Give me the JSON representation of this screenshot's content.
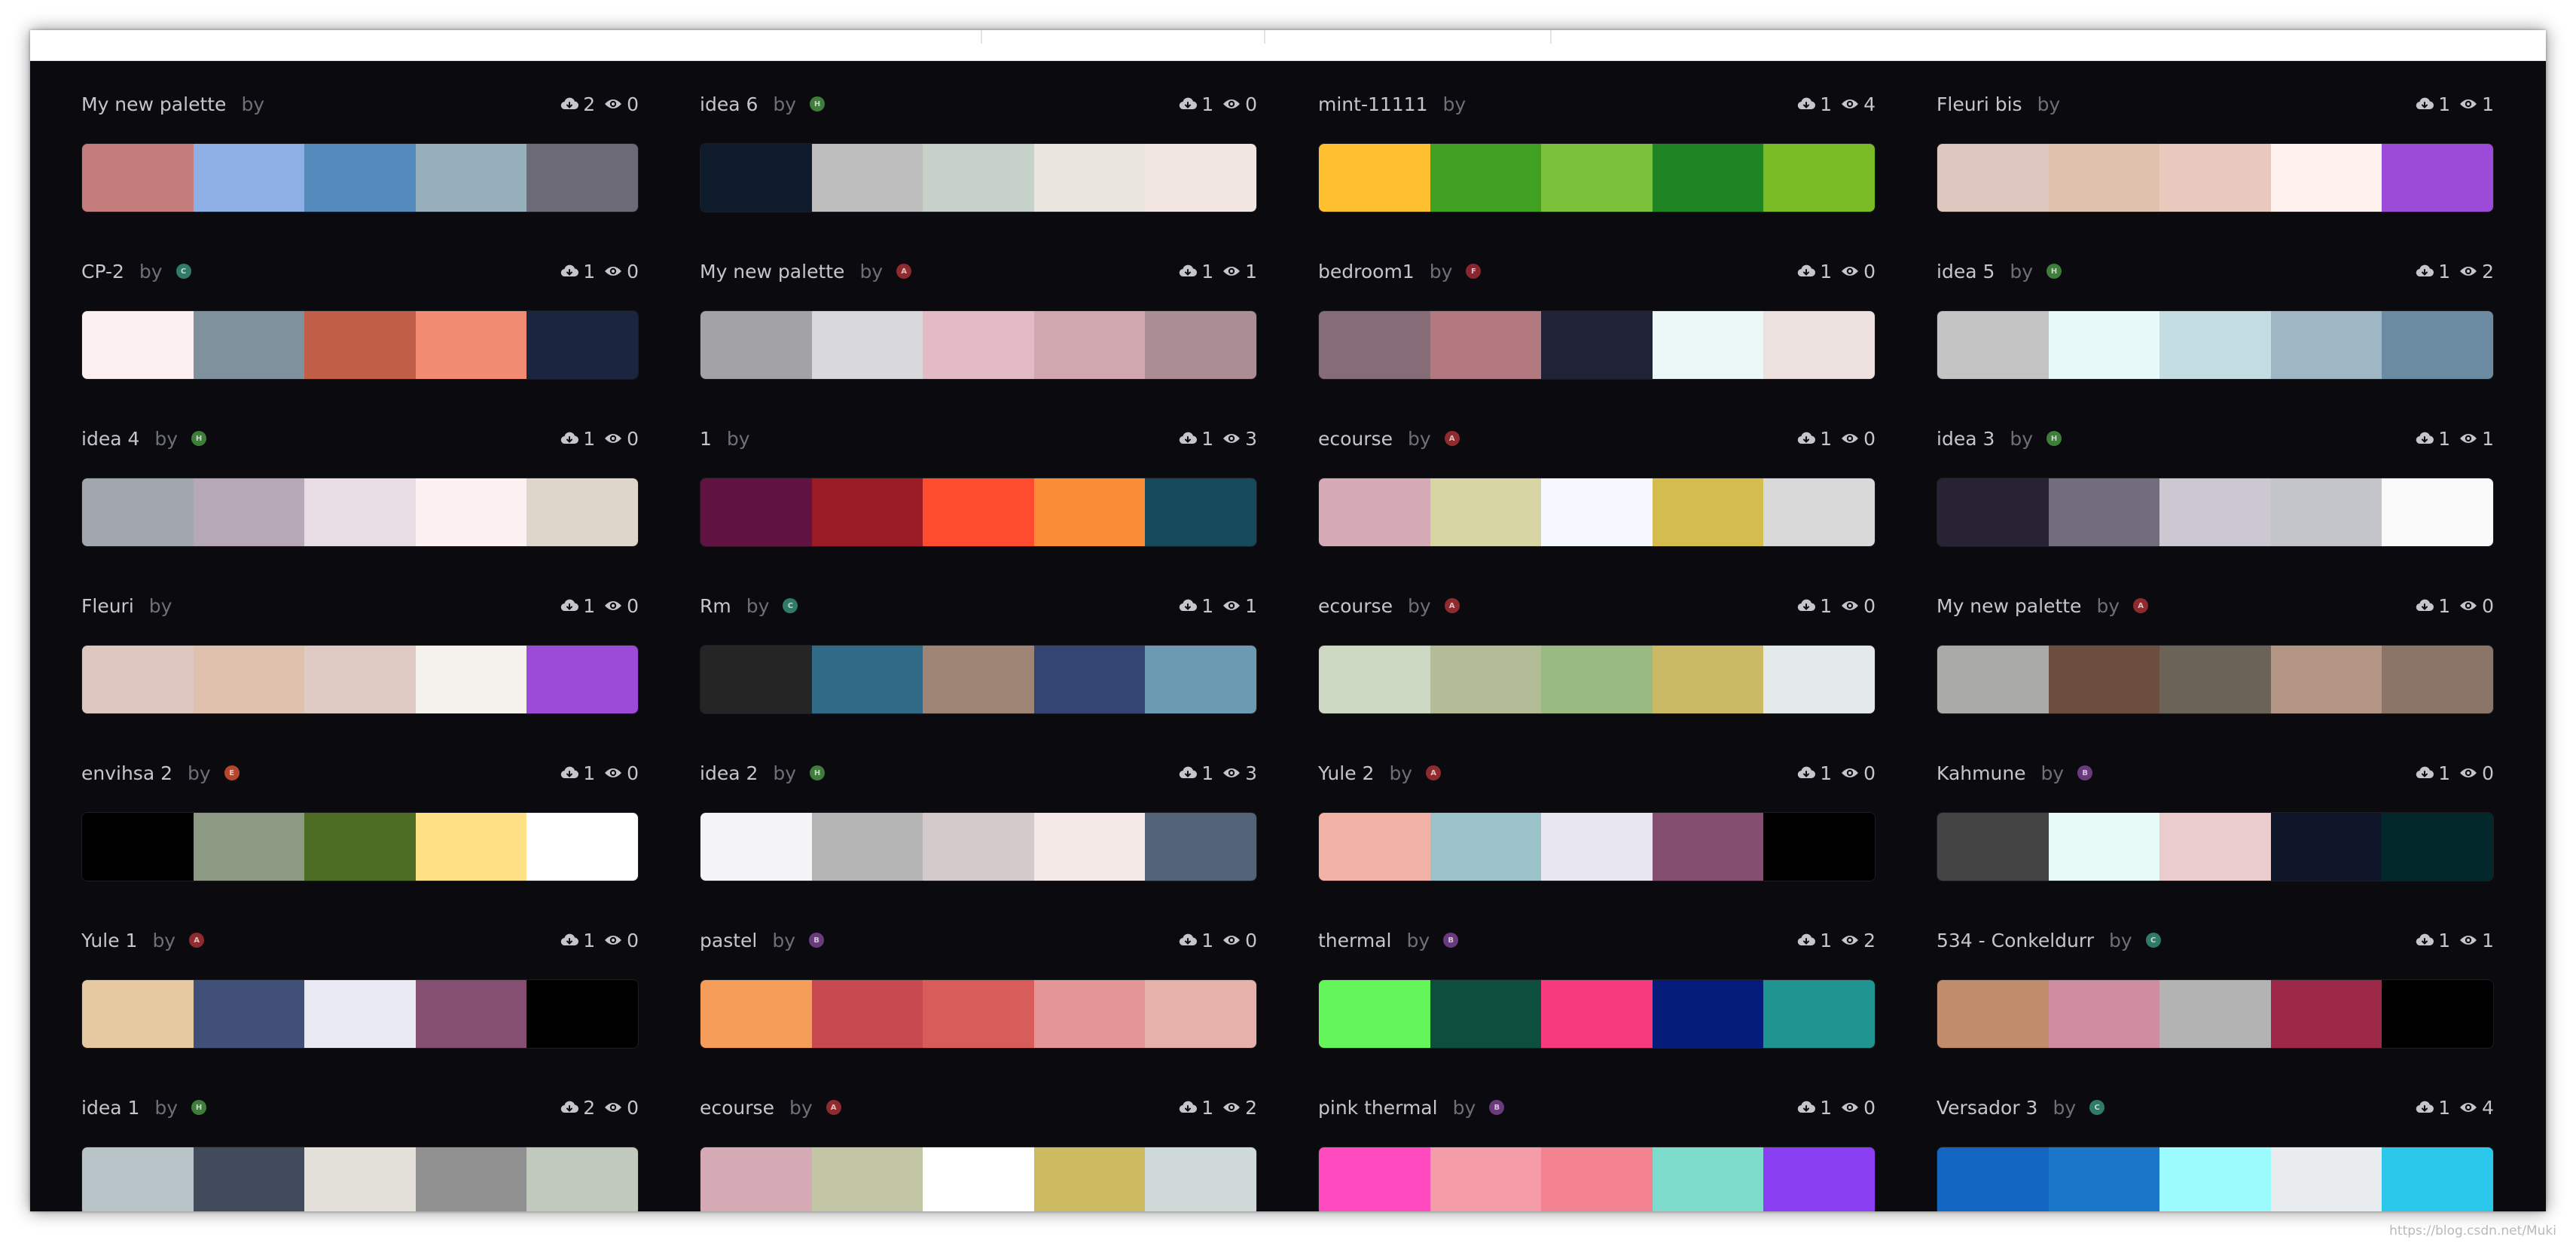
{
  "by_label": "by",
  "icons": {
    "downloads": "cloud-download-icon",
    "views": "eye-icon"
  },
  "watermark": "https://blog.csdn.net/Muki",
  "palettes": [
    {
      "name": "My new palette",
      "avatar": null,
      "downloads": "2",
      "views": "0",
      "colors": [
        "#c47c7c",
        "#8eaee6",
        "#548abc",
        "#97afbb",
        "#6d6a78"
      ]
    },
    {
      "name": "idea 6",
      "avatar": {
        "letter": "H",
        "color": "#3e7d3a"
      },
      "downloads": "1",
      "views": "0",
      "colors": [
        "#0e1c2c",
        "#bebebe",
        "#c6d1c9",
        "#ebe5df",
        "#f1e6e1"
      ]
    },
    {
      "name": "mint-11111",
      "avatar": null,
      "downloads": "1",
      "views": "4",
      "colors": [
        "#fec02f",
        "#40a022",
        "#7bc23a",
        "#1f8422",
        "#79bb25"
      ]
    },
    {
      "name": "Fleuri bis",
      "avatar": null,
      "downloads": "1",
      "views": "1",
      "colors": [
        "#ddc7bf",
        "#e0c1ad",
        "#e8c9bd",
        "#fff1ed",
        "#9c4bd8"
      ]
    },
    {
      "name": "CP-2",
      "avatar": {
        "letter": "C",
        "color": "#2f7a68"
      },
      "downloads": "1",
      "views": "0",
      "colors": [
        "#fcf0f0",
        "#7f919c",
        "#c05e47",
        "#f18b71",
        "#1c2540"
      ]
    },
    {
      "name": "My new palette",
      "avatar": {
        "letter": "A",
        "color": "#8f2a2f"
      },
      "downloads": "1",
      "views": "1",
      "colors": [
        "#a3a3a6",
        "#d9d9db",
        "#e3bbc4",
        "#d0a7af",
        "#ab8e93"
      ]
    },
    {
      "name": "bedroom1",
      "avatar": {
        "letter": "F",
        "color": "#8a2530"
      },
      "downloads": "1",
      "views": "0",
      "colors": [
        "#856c76",
        "#b37980",
        "#1f2335",
        "#ecf8f8",
        "#ede1e0"
      ]
    },
    {
      "name": "idea 5",
      "avatar": {
        "letter": "H",
        "color": "#3e7d3a"
      },
      "downloads": "1",
      "views": "2",
      "colors": [
        "#c3c3c3",
        "#e8f9f9",
        "#c3dde3",
        "#9fb6c5",
        "#6b8ba3"
      ]
    },
    {
      "name": "idea 4",
      "avatar": {
        "letter": "H",
        "color": "#3e7d3a"
      },
      "downloads": "1",
      "views": "0",
      "colors": [
        "#a2a7ae",
        "#b6a8b7",
        "#e8dde4",
        "#fdf0f0",
        "#ded6cb"
      ]
    },
    {
      "name": "1",
      "avatar": null,
      "downloads": "1",
      "views": "3",
      "colors": [
        "#5e1341",
        "#9a1b25",
        "#ff4c2f",
        "#fa8c35",
        "#16495c"
      ]
    },
    {
      "name": "ecourse",
      "avatar": {
        "letter": "A",
        "color": "#8f2a2f"
      },
      "downloads": "1",
      "views": "0",
      "colors": [
        "#d5aab4",
        "#d6d5a3",
        "#f5f9ff",
        "#d5bc4e",
        "#d9d9d9"
      ]
    },
    {
      "name": "idea 3",
      "avatar": {
        "letter": "H",
        "color": "#3e7d3a"
      },
      "downloads": "1",
      "views": "1",
      "colors": [
        "#272234",
        "#726d7c",
        "#cbc8d2",
        "#c4c5ca",
        "#fafafa"
      ]
    },
    {
      "name": "Fleuri",
      "avatar": null,
      "downloads": "1",
      "views": "0",
      "colors": [
        "#ddc7bf",
        "#e0c1ad",
        "#e0cbc4",
        "#f5f1ed",
        "#9c4bd8"
      ]
    },
    {
      "name": "Rm",
      "avatar": {
        "letter": "C",
        "color": "#2f7a68"
      },
      "downloads": "1",
      "views": "1",
      "colors": [
        "#252525",
        "#306a86",
        "#9e8474",
        "#354573",
        "#6c9ab3"
      ]
    },
    {
      "name": "ecourse",
      "avatar": {
        "letter": "A",
        "color": "#8f2a2f"
      },
      "downloads": "1",
      "views": "0",
      "colors": [
        "#cdd8c2",
        "#b4bb97",
        "#9aba84",
        "#cab965",
        "#e3e8e9"
      ]
    },
    {
      "name": "My new palette",
      "avatar": {
        "letter": "A",
        "color": "#8f2a2f"
      },
      "downloads": "1",
      "views": "0",
      "colors": [
        "#aaaaa9",
        "#6c4e41",
        "#6a6357",
        "#b29584",
        "#8a7566"
      ]
    },
    {
      "name": "envihsa 2",
      "avatar": {
        "letter": "E",
        "color": "#b5452c"
      },
      "downloads": "1",
      "views": "0",
      "colors": [
        "#000000",
        "#8d9a83",
        "#4c6c23",
        "#fde184",
        "#ffffff"
      ]
    },
    {
      "name": "idea 2",
      "avatar": {
        "letter": "H",
        "color": "#3e7d3a"
      },
      "downloads": "1",
      "views": "3",
      "colors": [
        "#f4f4f6",
        "#b4b4b4",
        "#d3c9cb",
        "#f4e9e6",
        "#526379"
      ]
    },
    {
      "name": "Yule 2",
      "avatar": {
        "letter": "A",
        "color": "#8f2a2f"
      },
      "downloads": "1",
      "views": "0",
      "colors": [
        "#f2b3a6",
        "#9bc2c9",
        "#e8e7f1",
        "#834e6f",
        "#000000"
      ]
    },
    {
      "name": "Kahmune",
      "avatar": {
        "letter": "B",
        "color": "#6a3a7e"
      },
      "downloads": "1",
      "views": "0",
      "colors": [
        "#444444",
        "#e8faf6",
        "#ebcccd",
        "#10162a",
        "#03282b"
      ]
    },
    {
      "name": "Yule 1",
      "avatar": {
        "letter": "A",
        "color": "#8f2a2f"
      },
      "downloads": "1",
      "views": "0",
      "colors": [
        "#e6c9a1",
        "#405078",
        "#e9e9f3",
        "#844f70",
        "#000000"
      ]
    },
    {
      "name": "pastel",
      "avatar": {
        "letter": "B",
        "color": "#6a3a7e"
      },
      "downloads": "1",
      "views": "0",
      "colors": [
        "#f49e59",
        "#c84850",
        "#d85c59",
        "#e49597",
        "#e7b1ab"
      ]
    },
    {
      "name": "thermal",
      "avatar": {
        "letter": "B",
        "color": "#6a3a7e"
      },
      "downloads": "1",
      "views": "2",
      "colors": [
        "#64f55a",
        "#0c4f3e",
        "#f53a7d",
        "#061c7b",
        "#1f9491"
      ]
    },
    {
      "name": "534 - Conkeldurr",
      "avatar": {
        "letter": "C",
        "color": "#2f7a68"
      },
      "downloads": "1",
      "views": "1",
      "colors": [
        "#c08c6b",
        "#d08c9f",
        "#b3b3b3",
        "#9e2847",
        "#000000"
      ]
    },
    {
      "name": "idea 1",
      "avatar": {
        "letter": "H",
        "color": "#3e7d3a"
      },
      "downloads": "2",
      "views": "0",
      "colors": [
        "#b8c4c7",
        "#414b5b",
        "#e2e0d8",
        "#919191",
        "#c1c9bd"
      ]
    },
    {
      "name": "ecourse",
      "avatar": {
        "letter": "A",
        "color": "#8f2a2f"
      },
      "downloads": "1",
      "views": "2",
      "colors": [
        "#d5aab4",
        "#c2c6a5",
        "#ffffff",
        "#cdbb62",
        "#cfd9d8"
      ]
    },
    {
      "name": "pink thermal",
      "avatar": {
        "letter": "B",
        "color": "#6a3a7e"
      },
      "downloads": "1",
      "views": "0",
      "colors": [
        "#ff4bbf",
        "#f49ca8",
        "#f28290",
        "#7ddbcb",
        "#8a3ff3"
      ]
    },
    {
      "name": "Versador 3",
      "avatar": {
        "letter": "C",
        "color": "#2f7a68"
      },
      "downloads": "1",
      "views": "4",
      "colors": [
        "#1266c2",
        "#1a76c8",
        "#9bfbfd",
        "#e9ecee",
        "#2bc8eb"
      ]
    }
  ]
}
